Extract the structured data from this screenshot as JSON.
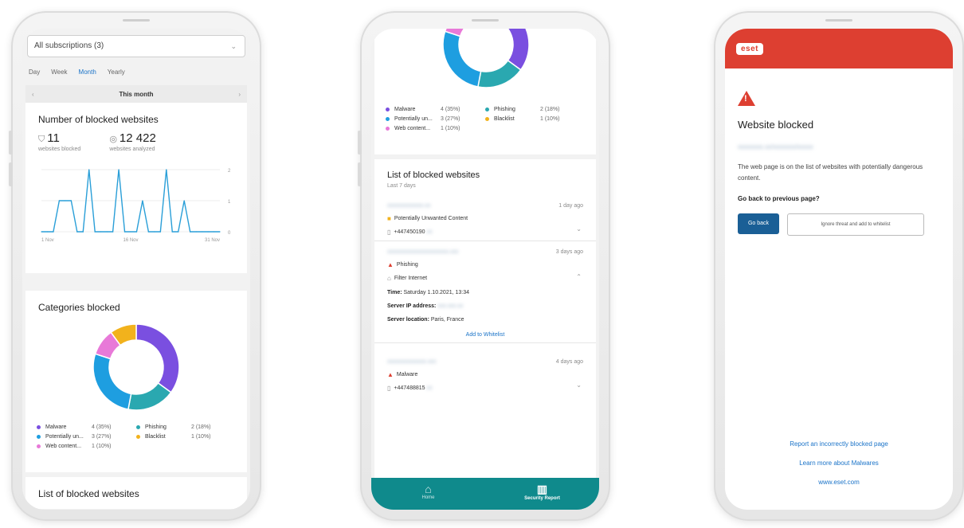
{
  "phone1": {
    "subscriptions_select": "All subscriptions (3)",
    "periods": [
      "Day",
      "Week",
      "Month",
      "Yearly"
    ],
    "active_period": "Month",
    "month_nav_label": "This month",
    "blocked_card": {
      "title": "Number of blocked websites",
      "blocked_count": "11",
      "blocked_label": "websites blocked",
      "analyzed_count": "12 422",
      "analyzed_label": "websites analyzed",
      "x_ticks": [
        "1 Nov",
        "16 Nov",
        "31 Nov"
      ],
      "y_ticks": [
        "2",
        "1",
        "0"
      ]
    },
    "categories_title": "Categories blocked",
    "list_title": "List of blocked websites"
  },
  "legend": [
    {
      "name": "Malware",
      "value": "4 (35%)",
      "color": "#7a4fe0"
    },
    {
      "name": "Phishing",
      "value": "2 (18%)",
      "color": "#2aa8b0"
    },
    {
      "name": "Potentially un...",
      "value": "3 (27%)",
      "color": "#1e9ee0"
    },
    {
      "name": "Blacklist",
      "value": "1 (10%)",
      "color": "#f2b21c"
    },
    {
      "name": "Web content...",
      "value": "1 (10%)",
      "color": "#e879d8"
    }
  ],
  "phone2": {
    "list_title": "List of blocked websites",
    "list_subtitle": "Last 7 days",
    "entries": [
      {
        "url": "xxxxxxxxxxxxx.xx",
        "ago": "1 day ago",
        "category": "Potentially Unwanted Content",
        "device": "+447450190"
      },
      {
        "url": "xxxxxxxxxxxxxxxxxxxxxx.xxx",
        "ago": "3 days ago",
        "category": "Phishing",
        "device": "Filter Internet",
        "time_label": "Time:",
        "time_value": "Saturday 1.10.2021, 13:34",
        "ip_label": "Server IP address:",
        "ip_value": "xxx.xxx.xx",
        "location_label": "Server location:",
        "location_value": "Paris, France",
        "whitelist_link": "Add to Whitelist"
      },
      {
        "url": "xxxxxxxxxxxxxx.xxx",
        "ago": "4 days ago",
        "category": "Malware",
        "device": "+447488815"
      }
    ],
    "tabs": [
      {
        "label": "Home",
        "icon": "home-icon",
        "active": false
      },
      {
        "label": "Security Report",
        "icon": "report-icon",
        "active": true
      }
    ]
  },
  "phone3": {
    "logo": "eset",
    "title": "Website blocked",
    "blocked_url": "xxxxxxxx.xx/xxxxxxx/xxxxx",
    "message": "The web page is on the list of websites with potentially dangerous content.",
    "question": "Go back to previous page?",
    "go_back": "Go back",
    "ignore": "Ignore threat and add to whitelist",
    "link_report": "Report an incorrectly blocked page",
    "link_learn": "Learn more about Malwares",
    "link_site": "www.eset.com"
  },
  "chart_data": [
    {
      "type": "line",
      "title": "Number of blocked websites",
      "x": [
        1,
        2,
        3,
        4,
        5,
        6,
        7,
        8,
        9,
        10,
        11,
        12,
        13,
        14,
        15,
        16,
        17,
        18,
        19,
        20,
        21,
        22,
        23,
        24,
        25,
        26,
        27,
        28,
        29,
        30,
        31
      ],
      "series": [
        {
          "values": [
            0,
            0,
            0,
            1,
            1,
            1,
            0,
            0,
            2,
            0,
            0,
            0,
            0,
            2,
            0,
            0,
            0,
            1,
            0,
            0,
            0,
            2,
            0,
            0,
            1,
            0,
            0,
            0,
            0,
            0,
            0
          ]
        }
      ],
      "ylim": [
        0,
        2
      ],
      "x_tick_labels": [
        "1 Nov",
        "16 Nov",
        "31 Nov"
      ]
    },
    {
      "type": "pie",
      "title": "Categories blocked",
      "labels": [
        "Malware",
        "Phishing",
        "Potentially un...",
        "Web content...",
        "Blacklist"
      ],
      "values": [
        35,
        18,
        27,
        10,
        10
      ],
      "colors": [
        "#7a4fe0",
        "#2aa8b0",
        "#1e9ee0",
        "#e879d8",
        "#f2b21c"
      ]
    }
  ]
}
